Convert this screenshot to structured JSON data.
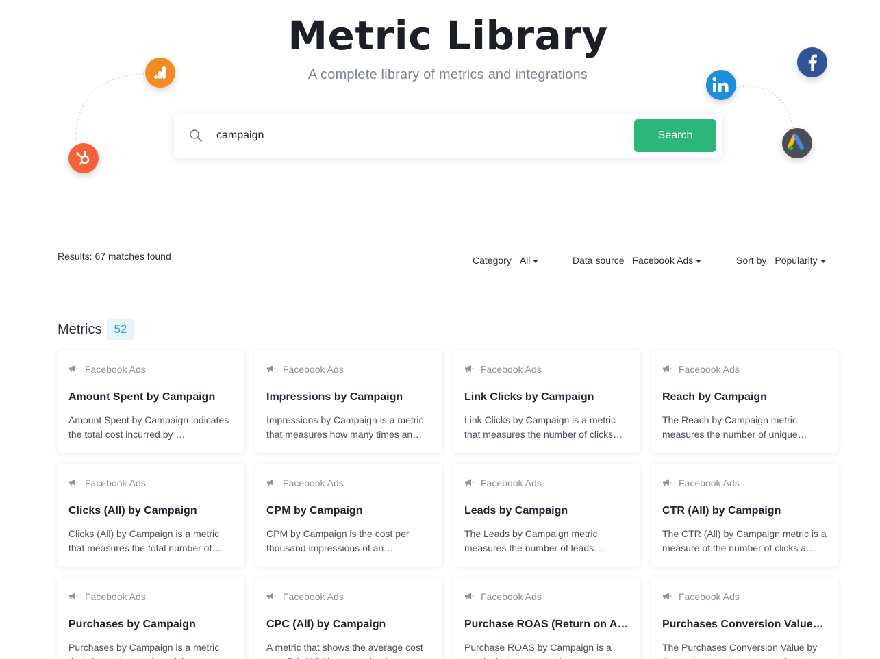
{
  "hero": {
    "title": "Metric Library",
    "subtitle": "A complete library of metrics and integrations"
  },
  "brand_icons": [
    "google-analytics-icon",
    "hubspot-icon",
    "linkedin-icon",
    "facebook-icon",
    "google-ads-icon"
  ],
  "colors": {
    "accent_green": "#2db679",
    "badge_bg": "#e6f4fb",
    "badge_text": "#2a9ad5",
    "analytics_orange": "#f58a24",
    "hubspot_orange": "#f4623a",
    "linkedin_blue": "#1d8fd9",
    "facebook_blue": "#2f5597"
  },
  "search": {
    "value": "campaign",
    "button_label": "Search"
  },
  "results_text": "Results: 67 matches found",
  "filters": {
    "category": {
      "label": "Category",
      "value": "All"
    },
    "data_source": {
      "label": "Data source",
      "value": "Facebook Ads"
    },
    "sort": {
      "label": "Sort by",
      "value": "Popularity"
    }
  },
  "section": {
    "title": "Metrics",
    "count": "52"
  },
  "cards": [
    {
      "source": "Facebook Ads",
      "title": "Amount Spent by Campaign",
      "desc": "Amount Spent by Campaign indicates the total cost incurred by …"
    },
    {
      "source": "Facebook Ads",
      "title": "Impressions by Campaign",
      "desc": "Impressions by Campaign is a metric that measures how many times an…"
    },
    {
      "source": "Facebook Ads",
      "title": "Link Clicks by Campaign",
      "desc": "Link Clicks by Campaign is a metric that measures the number of clicks…"
    },
    {
      "source": "Facebook Ads",
      "title": "Reach by Campaign",
      "desc": "The Reach by Campaign metric measures the number of unique…"
    },
    {
      "source": "Facebook Ads",
      "title": "Clicks (All) by Campaign",
      "desc": "Clicks (All) by Campaign is a metric that measures the total number of…"
    },
    {
      "source": "Facebook Ads",
      "title": "CPM by Campaign",
      "desc": "CPM by Campaign is the cost per thousand impressions of an…"
    },
    {
      "source": "Facebook Ads",
      "title": "Leads by Campaign",
      "desc": "The Leads by Campaign metric measures the number of leads…"
    },
    {
      "source": "Facebook Ads",
      "title": "CTR (All) by Campaign",
      "desc": "The CTR (All) by Campaign metric is a measure of the number of clicks a…"
    },
    {
      "source": "Facebook Ads",
      "title": "Purchases by Campaign",
      "desc": "Purchases by Campaign is a metric that shows the number of times…"
    },
    {
      "source": "Facebook Ads",
      "title": "CPC (All) by Campaign",
      "desc": "A metric that shows the average cost per click (CPC) across all ad…"
    },
    {
      "source": "Facebook Ads",
      "title": "Purchase ROAS (Return on Ad…",
      "desc": "Purchase ROAS by Campaign is a metric that measures the…"
    },
    {
      "source": "Facebook Ads",
      "title": "Purchases Conversion Value…",
      "desc": "The Purchases Conversion Value by Campaign metric measures the tot…"
    }
  ]
}
